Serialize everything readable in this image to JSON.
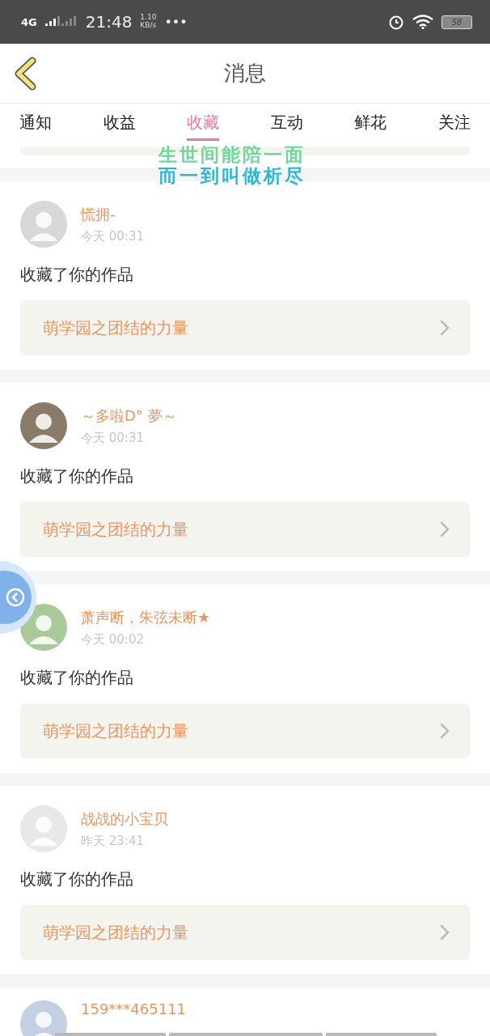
{
  "status_bar": {
    "network": "4G",
    "time": "21:48",
    "speed_value": "1.10",
    "speed_unit": "KB/s",
    "more": "•••",
    "battery": "58"
  },
  "header": {
    "title": "消息"
  },
  "tabs": [
    {
      "label": "通知",
      "selected": false
    },
    {
      "label": "收益",
      "selected": false
    },
    {
      "label": "收藏",
      "selected": true
    },
    {
      "label": "互动",
      "selected": false
    },
    {
      "label": "鲜花",
      "selected": false
    },
    {
      "label": "关注",
      "selected": false
    }
  ],
  "lyrics": [
    "生世间能陪一面",
    "而一到叫做析尽"
  ],
  "messages": [
    {
      "name": "慌拥-",
      "time": "今天 00:31",
      "action": "收藏了你的作品",
      "work": "萌学园之团结的力量"
    },
    {
      "name": "～多啦D° 夢～",
      "time": "今天 00:31",
      "action": "收藏了你的作品",
      "work": "萌学园之团结的力量"
    },
    {
      "name": "萧声断，朱弦未断★",
      "time": "今天 00:02",
      "action": "收藏了你的作品",
      "work": "萌学园之团结的力量"
    },
    {
      "name": "战战的小宝贝",
      "time": "昨天 23:41",
      "action": "收藏了你的作品",
      "work": "萌学园之团结的力量"
    }
  ],
  "partial_message": {
    "name": "159***465111"
  }
}
